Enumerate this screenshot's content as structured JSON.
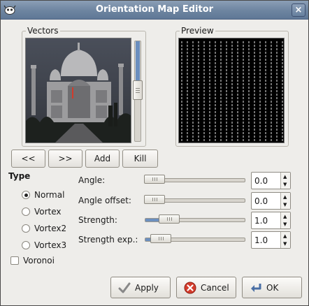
{
  "window": {
    "title": "Orientation Map Editor",
    "close_glyph": "×"
  },
  "vectors": {
    "label": "Vectors",
    "image_name": "taj-mahal-photo",
    "scroll_level": 0.43
  },
  "preview": {
    "label": "Preview"
  },
  "nav_buttons": {
    "prev": "<<",
    "next": ">>",
    "add": "Add",
    "kill": "Kill"
  },
  "type": {
    "title": "Type",
    "options": [
      "Normal",
      "Vortex",
      "Vortex2",
      "Vortex3"
    ],
    "selected": "Normal",
    "voronoi_label": "Voronoi",
    "voronoi_checked": false
  },
  "params": [
    {
      "label": "Angle:",
      "value": "0.0",
      "fraction": 0.0
    },
    {
      "label": "Angle offset:",
      "value": "0.0",
      "fraction": 0.0
    },
    {
      "label": "Strength:",
      "value": "1.0",
      "fraction": 0.2
    },
    {
      "label": "Strength exp.:",
      "value": "1.0",
      "fraction": 0.1
    }
  ],
  "actions": {
    "apply": "Apply",
    "cancel": "Cancel",
    "ok": "OK"
  },
  "colors": {
    "accent": "#6b8fbf",
    "titlebar": "#6d84a0"
  }
}
